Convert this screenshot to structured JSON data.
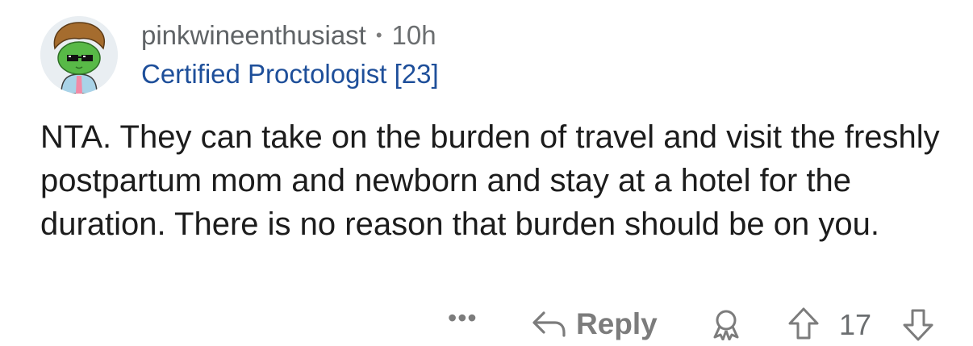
{
  "comment": {
    "author": {
      "username": "pinkwineenthusiast",
      "separator": "•",
      "timestamp": "10h",
      "flair": "Certified Proctologist [23]",
      "avatar_icon": "avatar-icon"
    },
    "body": "NTA. They can take on the burden of travel and visit the freshly postpartum mom and newborn and stay at a hotel for the duration. There is no reason that burden should be on you.",
    "actions": {
      "more_label": "•••",
      "reply_label": "Reply",
      "score": "17"
    }
  },
  "colors": {
    "flair": "#1e4f9a",
    "meta": "#6b6e70",
    "text": "#1c1c1c",
    "icon": "#7c7c7c"
  },
  "icons": [
    "avatar-icon",
    "reply-arrow-icon",
    "award-icon",
    "upvote-icon",
    "downvote-icon",
    "more-icon"
  ]
}
